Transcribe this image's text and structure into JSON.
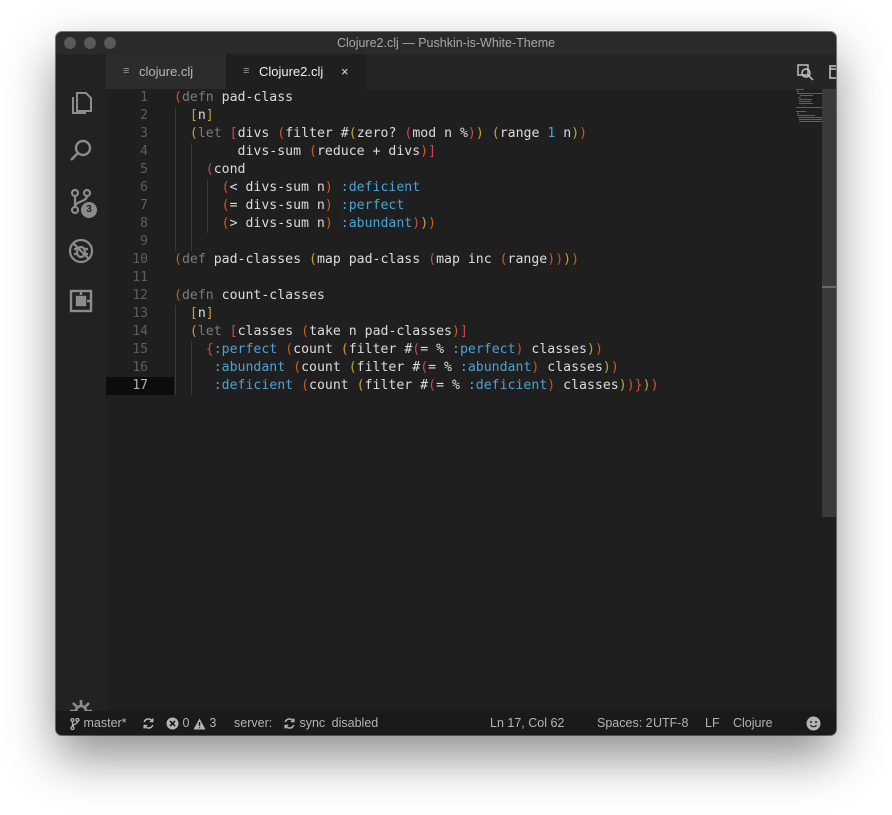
{
  "window": {
    "title": "Clojure2.clj — Pushkin-is-White-Theme"
  },
  "activity_bar": {
    "items": [
      {
        "name": "explorer-icon"
      },
      {
        "name": "search-icon"
      },
      {
        "name": "source-control-icon",
        "badge": "3"
      },
      {
        "name": "debug-icon"
      },
      {
        "name": "extensions-icon"
      }
    ],
    "settings": "gear-icon"
  },
  "tabs": [
    {
      "label": "clojure.clj",
      "icon": "file-lines-icon",
      "active": false
    },
    {
      "label": "Clojure2.clj",
      "icon": "file-lines-icon",
      "active": true,
      "close": "×"
    }
  ],
  "editor": {
    "line_numbers": [
      "1",
      "2",
      "3",
      "4",
      "5",
      "6",
      "7",
      "8",
      "9",
      "10",
      "11",
      "12",
      "13",
      "14",
      "15",
      "16",
      "17"
    ],
    "current_line": "17",
    "code_lines": [
      "(defn pad-class",
      "  [n]",
      "  (let [divs (filter #(zero? (mod n %)) (range 1 n))",
      "        divs-sum (reduce + divs)]",
      "    (cond",
      "      (< divs-sum n) :deficient",
      "      (= divs-sum n) :perfect",
      "      (> divs-sum n) :abundant)))",
      "",
      "(def pad-classes (map pad-class (map inc (range))))",
      "",
      "(defn count-classes",
      "  [n]",
      "  (let [classes (take n pad-classes)]",
      "    {:perfect (count (filter #(= % :perfect) classes))",
      "     :abundant (count (filter #(= % :abundant) classes))",
      "     :deficient (count (filter #(= % :deficient) classes))}))"
    ]
  },
  "status_bar": {
    "branch": "master*",
    "errors": "0",
    "warnings": "3",
    "server": "server:",
    "sync": "sync",
    "disabled": "disabled",
    "position": "Ln 17, Col 62",
    "spaces": "Spaces: 2",
    "encoding": "UTF-8",
    "eol": "LF",
    "language": "Clojure"
  },
  "colors": {
    "background": "#1f1f1f",
    "keyword": "#7b7b7b",
    "keyword_literal": "#4aa3d6",
    "paren_level_1": "#d25a1a",
    "paren_level_2": "#c8a032",
    "paren_level_3": "#c84a50"
  }
}
